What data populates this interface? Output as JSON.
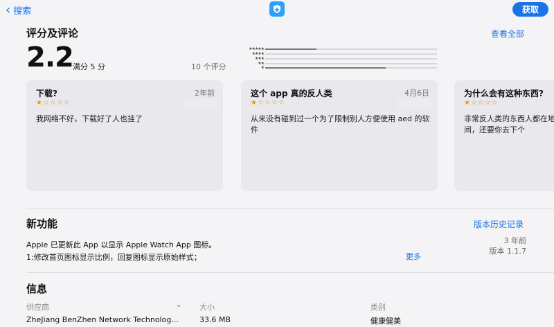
{
  "topbar": {
    "back_label": "搜索",
    "get_label": "获取"
  },
  "ratings": {
    "section_title": "评分及评论",
    "see_all": "查看全部",
    "score": "2.2",
    "out_of": "满分 5 分",
    "count": "10 个评分",
    "distribution": [
      0.3,
      0.0,
      0.0,
      0.0,
      0.7
    ]
  },
  "reviews": [
    {
      "title": "下载?",
      "date": "2年前",
      "rating": 1,
      "body": "我网络不好，下载好了人也挂了"
    },
    {
      "title": "这个 app 真的反人类",
      "date": "4月6日",
      "rating": 1,
      "body": "从来没有碰到过一个为了限制别人方便使用 aed 的软件"
    },
    {
      "title": "为什么会有这种东西?",
      "date": "",
      "rating": 1,
      "body": "非常反人类的东西人都在地的黄金时间，还要你去下个"
    }
  ],
  "whatsnew": {
    "section_title": "新功能",
    "history_link": "版本历史记录",
    "line1": "Apple 已更新此 App 以显示 Apple Watch App 图标。",
    "line2": "1:修改首页图标显示比例，回复图标显示原始样式；",
    "more": "更多",
    "ago": "3 年前",
    "version": "版本 1.1.7"
  },
  "info": {
    "section_title": "信息",
    "provider_label": "供应商",
    "provider_value": "ZheJiang BenZhen Network Technolog...",
    "size_label": "大小",
    "size_value": "33.6 MB",
    "category_label": "类别",
    "category_value": "健康健美"
  },
  "colors": {
    "accent": "#1a74e8",
    "star": "#e0a000"
  }
}
